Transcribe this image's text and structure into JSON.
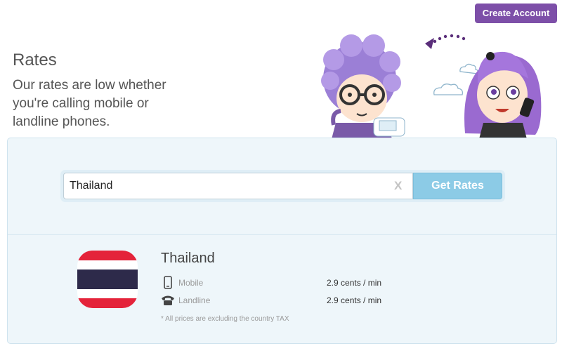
{
  "header": {
    "create_account_label": "Create Account"
  },
  "hero": {
    "title": "Rates",
    "subtitle": "Our rates are low whether you're calling mobile or landline phones."
  },
  "search": {
    "value": "Thailand",
    "clear_label": "X",
    "button_label": "Get Rates"
  },
  "result": {
    "country": "Thailand",
    "flag_icon": "thailand-flag-icon",
    "flag_colors": [
      "#e4233a",
      "#ffffff",
      "#2d2a4a",
      "#ffffff",
      "#e4233a"
    ],
    "rates": [
      {
        "type": "Mobile",
        "icon": "mobile-phone-icon",
        "price": "2.9 cents / min"
      },
      {
        "type": "Landline",
        "icon": "landline-phone-icon",
        "price": "2.9 cents / min"
      }
    ],
    "tax_note": "* All prices are excluding the country TAX"
  },
  "colors": {
    "accent": "#7d4fa8",
    "button": "#8ccbe6",
    "panel_bg": "#eef6fa"
  }
}
